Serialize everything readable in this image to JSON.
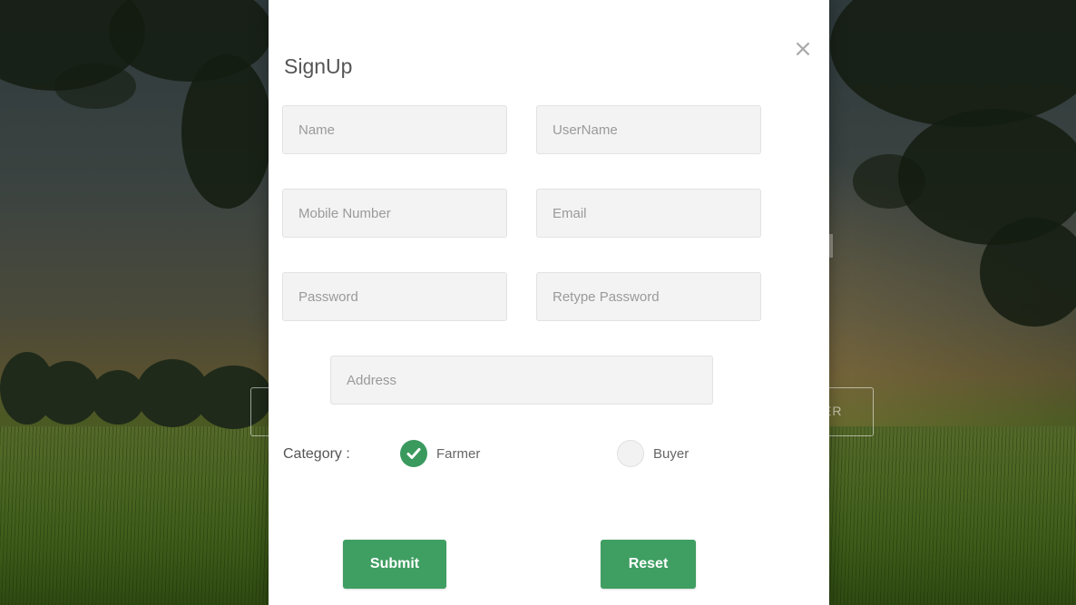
{
  "modal": {
    "title": "SignUp",
    "close_symbol": "×"
  },
  "form": {
    "name_placeholder": "Name",
    "username_placeholder": "UserName",
    "mobile_placeholder": "Mobile Number",
    "email_placeholder": "Email",
    "password_placeholder": "Password",
    "retype_password_placeholder": "Retype Password",
    "address_placeholder": "Address",
    "category_label": "Category :",
    "category_options": [
      {
        "label": "Farmer",
        "selected": true
      },
      {
        "label": "Buyer",
        "selected": false
      }
    ],
    "submit_label": "Submit",
    "reset_label": "Reset"
  },
  "background": {
    "right_button_fragment": "ER"
  },
  "colors": {
    "accent": "#3f9e62",
    "modal_bg": "#ffffff",
    "field_bg": "#f3f3f3"
  },
  "icons": {
    "close": "close-icon",
    "checked": "check-icon"
  }
}
